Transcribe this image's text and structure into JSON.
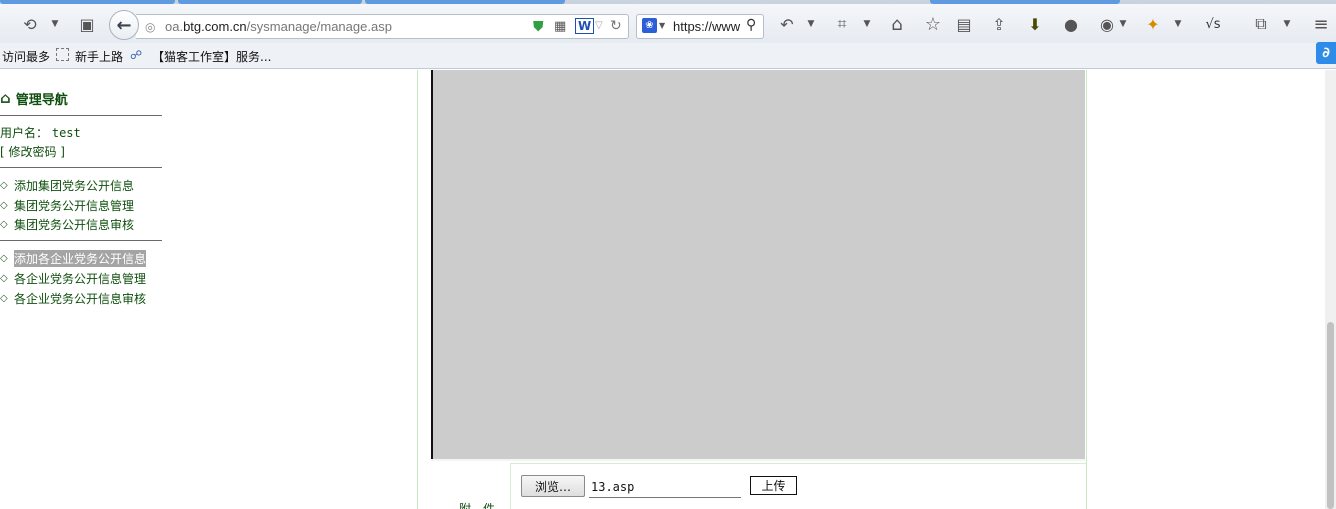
{
  "browser": {
    "url_prefix": "oa.",
    "url_host": "btg.com.cn",
    "url_path": "/sysmanage/manage.asp",
    "search_value": "https://www",
    "right_text": "√s"
  },
  "bookmarks": [
    "访问最多",
    "新手上路",
    "【猫客工作室】服务..."
  ],
  "sidebar": {
    "title": "管理导航",
    "username_label": "用户名：",
    "username_value": "test",
    "change_password": "[ 修改密码 ]",
    "group_menu": [
      "添加集团党务公开信息",
      "集团党务公开信息管理",
      "集团党务公开信息审核"
    ],
    "company_menu": [
      "添加各企业党务公开信息",
      "各企业党务公开信息管理",
      "各企业党务公开信息审核"
    ]
  },
  "form": {
    "browse_label": "浏览…",
    "file_value": "13.asp",
    "upload_label": "上传",
    "attachment_label": "附件"
  },
  "colors": {
    "nav_text": "#0f4f0f",
    "editor_bg": "#cccccc",
    "selected_bg": "#a4a4a4"
  }
}
